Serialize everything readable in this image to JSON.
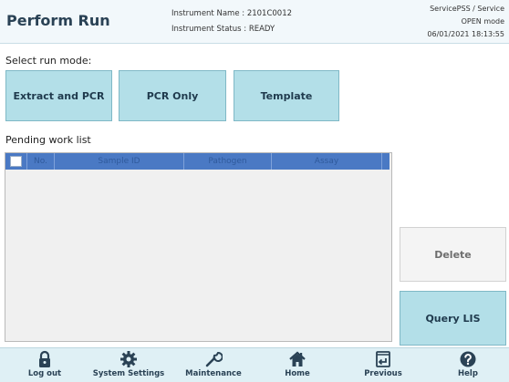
{
  "header": {
    "title": "Perform Run",
    "instrument_name": "Instrument Name : 2101C0012",
    "instrument_status": "Instrument Status : READY",
    "user": "ServicePSS / Service",
    "mode": "OPEN mode",
    "datetime": "06/01/2021 18:13:55"
  },
  "run_mode": {
    "label": "Select run mode:",
    "buttons": [
      "Extract and PCR",
      "PCR Only",
      "Template"
    ]
  },
  "worklist": {
    "label": "Pending work list",
    "columns": [
      "No.",
      "Sample ID",
      "Pathogen",
      "Assay"
    ],
    "rows": []
  },
  "actions": {
    "delete": "Delete",
    "query_lis": "Query LIS"
  },
  "footer": {
    "items": [
      {
        "label": "Log out",
        "icon": "lock-icon"
      },
      {
        "label": "System Settings",
        "icon": "gear-icon"
      },
      {
        "label": "Maintenance",
        "icon": "wrench-icon"
      },
      {
        "label": "Home",
        "icon": "home-icon"
      },
      {
        "label": "Previous",
        "icon": "previous-icon"
      },
      {
        "label": "Help",
        "icon": "help-icon"
      }
    ]
  },
  "colors": {
    "accent": "#b3dfe8",
    "header_bg": "#f2f8fb",
    "table_header": "#4a79c4",
    "footer_bg": "#dff0f5"
  }
}
